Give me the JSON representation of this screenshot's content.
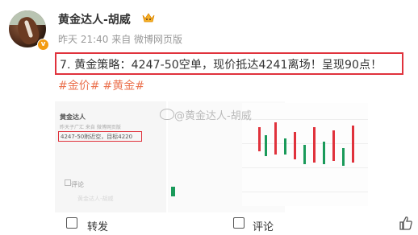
{
  "user": {
    "name": "黄金达人-胡威",
    "time": "昨天 21:40",
    "source": "来自 微博网页版",
    "verified_color": "#f39c12"
  },
  "post": {
    "text": "7. 黄金策略：4247-50空单，现价抵达4241离场！呈现90点！",
    "highlight_color": "#e0323c",
    "tags": [
      "#金价#",
      "#黄金#"
    ],
    "tag_color": "#eb7350"
  },
  "images": {
    "mini_name": "黄金达人",
    "mini_meta": "昨天子广汇 来自 微博网页版",
    "mini_text": "4247-50附近空，目标4220",
    "mini_action": "评论",
    "mini_faded": "黄金达人-胡威",
    "watermark": "@黄金达人-胡威"
  },
  "actions": {
    "share": "转发",
    "comment": "评论",
    "like_icon": "thumbs-up-icon"
  }
}
